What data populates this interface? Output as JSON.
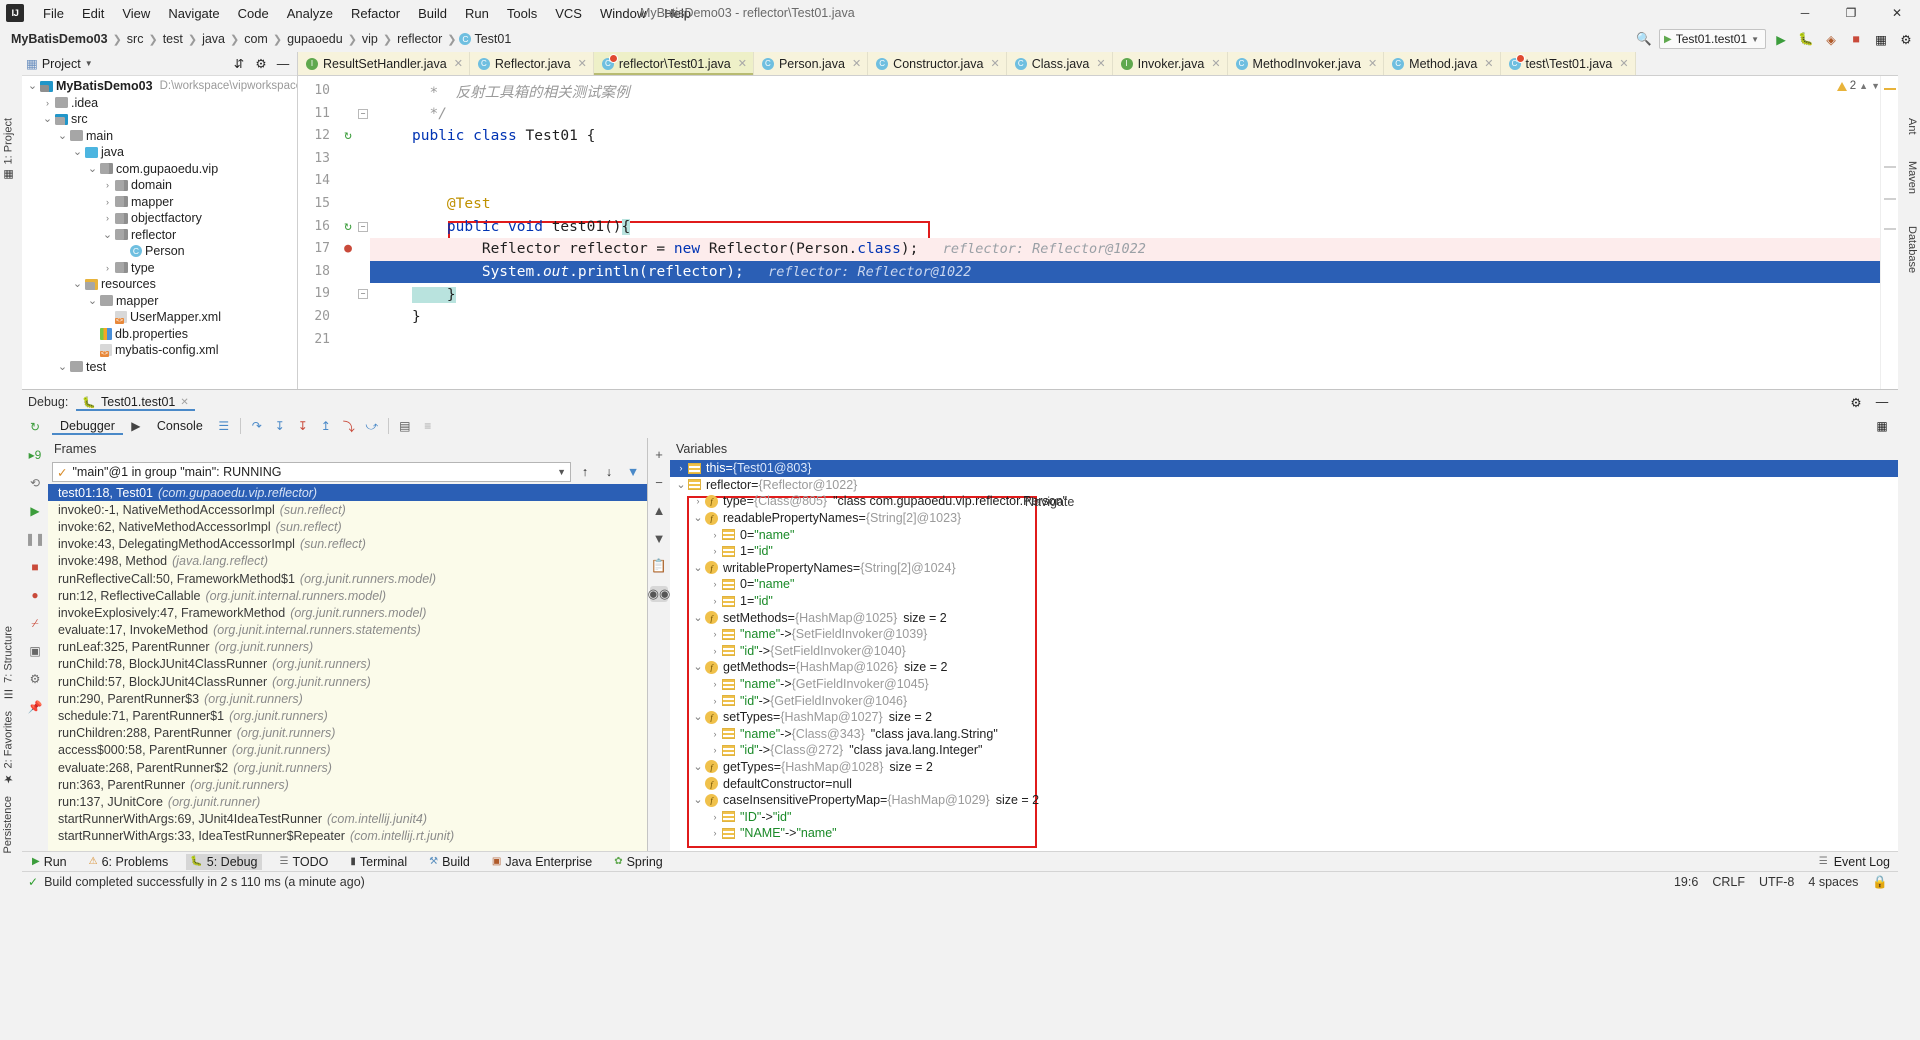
{
  "window": {
    "title": "MyBatisDemo03 - reflector\\Test01.java",
    "logo": "IJ",
    "minimize": "─",
    "maximize": "❐",
    "close": "✕"
  },
  "menu": [
    "File",
    "Edit",
    "View",
    "Navigate",
    "Code",
    "Analyze",
    "Refactor",
    "Build",
    "Run",
    "Tools",
    "VCS",
    "Window",
    "Help"
  ],
  "breadcrumb": [
    "MyBatisDemo03",
    "src",
    "test",
    "java",
    "com",
    "gupaoedu",
    "vip",
    "reflector",
    "Test01"
  ],
  "nav_right": {
    "run_config": "Test01.test01",
    "search_icon": "search-icon",
    "run_icon": "▶",
    "debug_icon": "debug-icon",
    "coverage_icon": "coverage-icon",
    "stop_icon": "■",
    "layout_icon": "layout-icon",
    "settings_icon": "⚙"
  },
  "project_panel": {
    "title": "Project",
    "header_icons": [
      "collapse-all-icon",
      "settings-icon",
      "hide-icon"
    ],
    "tree": [
      {
        "depth": 0,
        "arrow": "v",
        "icon": "proj",
        "label": "MyBatisDemo03",
        "bold": true,
        "path": "D:\\workspace\\vipworkspace\\MyB"
      },
      {
        "depth": 1,
        "arrow": ">",
        "icon": "folder",
        "label": ".idea"
      },
      {
        "depth": 1,
        "arrow": "v",
        "icon": "folder-src",
        "label": "src"
      },
      {
        "depth": 2,
        "arrow": "v",
        "icon": "folder",
        "label": "main"
      },
      {
        "depth": 3,
        "arrow": "v",
        "icon": "folder-java",
        "label": "java"
      },
      {
        "depth": 4,
        "arrow": "v",
        "icon": "pkg",
        "label": "com.gupaoedu.vip"
      },
      {
        "depth": 5,
        "arrow": ">",
        "icon": "pkg",
        "label": "domain"
      },
      {
        "depth": 5,
        "arrow": ">",
        "icon": "pkg",
        "label": "mapper"
      },
      {
        "depth": 5,
        "arrow": ">",
        "icon": "pkg",
        "label": "objectfactory"
      },
      {
        "depth": 5,
        "arrow": "v",
        "icon": "pkg",
        "label": "reflector"
      },
      {
        "depth": 6,
        "arrow": "",
        "icon": "class",
        "label": "Person"
      },
      {
        "depth": 5,
        "arrow": ">",
        "icon": "pkg",
        "label": "type"
      },
      {
        "depth": 3,
        "arrow": "v",
        "icon": "folder-res",
        "label": "resources"
      },
      {
        "depth": 4,
        "arrow": "v",
        "icon": "folder",
        "label": "mapper"
      },
      {
        "depth": 5,
        "arrow": "",
        "icon": "xml",
        "label": "UserMapper.xml"
      },
      {
        "depth": 4,
        "arrow": "",
        "icon": "prop",
        "label": "db.properties"
      },
      {
        "depth": 4,
        "arrow": "",
        "icon": "xml",
        "label": "mybatis-config.xml"
      },
      {
        "depth": 2,
        "arrow": "v",
        "icon": "folder",
        "label": "test"
      }
    ]
  },
  "editor": {
    "tabs": [
      {
        "label": "ResultSetHandler.java",
        "icon": "interface-icon",
        "active": false
      },
      {
        "label": "Reflector.java",
        "icon": "class-icon",
        "active": false
      },
      {
        "label": "reflector\\Test01.java",
        "icon": "test-class-icon",
        "active": true
      },
      {
        "label": "Person.java",
        "icon": "class-icon",
        "active": false
      },
      {
        "label": "Constructor.java",
        "icon": "class-icon",
        "active": false
      },
      {
        "label": "Class.java",
        "icon": "class-icon",
        "active": false
      },
      {
        "label": "Invoker.java",
        "icon": "interface-icon",
        "active": false
      },
      {
        "label": "MethodInvoker.java",
        "icon": "class-icon",
        "active": false
      },
      {
        "label": "Method.java",
        "icon": "class-icon",
        "active": false
      },
      {
        "label": "test\\Test01.java",
        "icon": "test-class-icon",
        "active": false
      }
    ],
    "tab_close": "✕",
    "inspection_count": "2",
    "lines": [
      {
        "num": "10",
        "gutter": "",
        "fold": "",
        "state": "normal",
        "segments": [
          {
            "cls": "cmt",
            "text": "  *  反射工具箱的相关测试案例"
          }
        ]
      },
      {
        "num": "11",
        "gutter": "",
        "fold": "end",
        "state": "normal",
        "segments": [
          {
            "cls": "cmt",
            "text": "  */"
          }
        ]
      },
      {
        "num": "12",
        "gutter": "recursive-icon",
        "fold": "",
        "state": "normal",
        "segments": [
          {
            "cls": "kw",
            "text": "public class "
          },
          {
            "cls": "plain",
            "text": "Test01 {"
          }
        ]
      },
      {
        "num": "13",
        "gutter": "",
        "fold": "",
        "state": "normal",
        "segments": []
      },
      {
        "num": "14",
        "gutter": "",
        "fold": "",
        "state": "normal",
        "segments": []
      },
      {
        "num": "15",
        "gutter": "",
        "fold": "",
        "state": "normal",
        "segments": [
          {
            "cls": "ann",
            "text": "    @Test"
          }
        ]
      },
      {
        "num": "16",
        "gutter": "recursive-icon",
        "fold": "start",
        "state": "normal",
        "segments": [
          {
            "cls": "kw",
            "text": "    public void "
          },
          {
            "cls": "plain",
            "text": "test01()"
          },
          {
            "cls": "caret",
            "text": "{"
          }
        ]
      },
      {
        "num": "17",
        "gutter": "breakpoint-icon",
        "fold": "",
        "state": "exec",
        "segments": [
          {
            "cls": "plain",
            "text": "        Reflector reflector = "
          },
          {
            "cls": "kw",
            "text": "new "
          },
          {
            "cls": "plain",
            "text": "Reflector(Person."
          },
          {
            "cls": "kw",
            "text": "class"
          },
          {
            "cls": "plain",
            "text": ");"
          },
          {
            "cls": "hint",
            "text": "   reflector: Reflector@1022"
          }
        ]
      },
      {
        "num": "18",
        "gutter": "",
        "fold": "",
        "state": "sel",
        "segments": [
          {
            "cls": "plain",
            "text": "        System."
          },
          {
            "cls": "italic",
            "text": "out"
          },
          {
            "cls": "plain",
            "text": ".println(reflector);"
          },
          {
            "cls": "hint",
            "text": "   reflector: Reflector@1022"
          }
        ]
      },
      {
        "num": "19",
        "gutter": "",
        "fold": "end",
        "state": "normal",
        "segments": [
          {
            "cls": "caret",
            "text": "    }"
          }
        ]
      },
      {
        "num": "20",
        "gutter": "",
        "fold": "",
        "state": "normal",
        "segments": [
          {
            "cls": "plain",
            "text": "}"
          }
        ]
      },
      {
        "num": "21",
        "gutter": "",
        "fold": "",
        "state": "normal",
        "segments": []
      }
    ]
  },
  "debug": {
    "label": "Debug:",
    "session_tab": "Test01.test01",
    "session_close": "✕",
    "head_right_icons": [
      "settings-icon",
      "minimize-icon"
    ],
    "toolbar": {
      "tabs": [
        {
          "label": "Debugger",
          "active": true
        },
        {
          "label": "Console",
          "active": false
        }
      ],
      "icons": [
        "layout-icon",
        "step-over-icon",
        "step-into-icon",
        "force-step-into-icon",
        "step-out-icon",
        "drop-frame-icon",
        "run-to-cursor-icon",
        "evaluate-icon",
        "mute-breakpoints-icon"
      ],
      "right_icon": "restore-layout-icon"
    },
    "side_icons": [
      "rerun-icon",
      "rerun-failed-icon",
      "resume-icon",
      "pause-icon",
      "stop-icon",
      "view-breakpoints-icon",
      "mute-breakpoints-icon",
      "settings-icon",
      "pin-icon"
    ],
    "frames": {
      "title": "Frames",
      "thread": "\"main\"@1 in group \"main\": RUNNING",
      "thread_check": "✓",
      "toolbar_icons": [
        "up-icon",
        "down-icon",
        "filter-icon"
      ],
      "items": [
        {
          "text": "test01:18, Test01",
          "pkg": "(com.gupaoedu.vip.reflector)",
          "active": true
        },
        {
          "text": "invoke0:-1, NativeMethodAccessorImpl",
          "pkg": "(sun.reflect)",
          "active": false
        },
        {
          "text": "invoke:62, NativeMethodAccessorImpl",
          "pkg": "(sun.reflect)",
          "active": false
        },
        {
          "text": "invoke:43, DelegatingMethodAccessorImpl",
          "pkg": "(sun.reflect)",
          "active": false
        },
        {
          "text": "invoke:498, Method",
          "pkg": "(java.lang.reflect)",
          "active": false
        },
        {
          "text": "runReflectiveCall:50, FrameworkMethod$1",
          "pkg": "(org.junit.runners.model)",
          "active": false
        },
        {
          "text": "run:12, ReflectiveCallable",
          "pkg": "(org.junit.internal.runners.model)",
          "active": false
        },
        {
          "text": "invokeExplosively:47, FrameworkMethod",
          "pkg": "(org.junit.runners.model)",
          "active": false
        },
        {
          "text": "evaluate:17, InvokeMethod",
          "pkg": "(org.junit.internal.runners.statements)",
          "active": false
        },
        {
          "text": "runLeaf:325, ParentRunner",
          "pkg": "(org.junit.runners)",
          "active": false
        },
        {
          "text": "runChild:78, BlockJUnit4ClassRunner",
          "pkg": "(org.junit.runners)",
          "active": false
        },
        {
          "text": "runChild:57, BlockJUnit4ClassRunner",
          "pkg": "(org.junit.runners)",
          "active": false
        },
        {
          "text": "run:290, ParentRunner$3",
          "pkg": "(org.junit.runners)",
          "active": false
        },
        {
          "text": "schedule:71, ParentRunner$1",
          "pkg": "(org.junit.runners)",
          "active": false
        },
        {
          "text": "runChildren:288, ParentRunner",
          "pkg": "(org.junit.runners)",
          "active": false
        },
        {
          "text": "access$000:58, ParentRunner",
          "pkg": "(org.junit.runners)",
          "active": false
        },
        {
          "text": "evaluate:268, ParentRunner$2",
          "pkg": "(org.junit.runners)",
          "active": false
        },
        {
          "text": "run:363, ParentRunner",
          "pkg": "(org.junit.runners)",
          "active": false
        },
        {
          "text": "run:137, JUnitCore",
          "pkg": "(org.junit.runner)",
          "active": false
        },
        {
          "text": "startRunnerWithArgs:69, JUnit4IdeaTestRunner",
          "pkg": "(com.intellij.junit4)",
          "active": false
        },
        {
          "text": "startRunnerWithArgs:33, IdeaTestRunner$Repeater",
          "pkg": "(com.intellij.rt.junit)",
          "active": false
        }
      ]
    },
    "variables": {
      "title": "Variables",
      "navigate_label": "Navigate",
      "toolbar_icons": [
        "add-icon",
        "remove-icon",
        "up-icon",
        "down-icon",
        "copy-icon",
        "inspect-icon"
      ],
      "items": [
        {
          "depth": 0,
          "arrow": ">",
          "icon": "list",
          "name": "this",
          "eq": " = ",
          "val": "{Test01@803}",
          "valcls": "gray",
          "sel": true
        },
        {
          "depth": 0,
          "arrow": "v",
          "icon": "list",
          "name": "reflector",
          "eq": " = ",
          "val": "{Reflector@1022}",
          "valcls": "gray"
        },
        {
          "depth": 1,
          "arrow": ">",
          "icon": "field",
          "name": "type",
          "eq": " = ",
          "val": "{Class@805}",
          "valcls": "gray",
          "extra": "\"class com.gupaoedu.vip.reflector.Person\"",
          "extracls": "plain"
        },
        {
          "depth": 1,
          "arrow": "v",
          "icon": "field",
          "name": "readablePropertyNames",
          "eq": " = ",
          "val": "{String[2]@1023}",
          "valcls": "gray"
        },
        {
          "depth": 2,
          "arrow": ">",
          "icon": "list",
          "name": "0",
          "eq": " = ",
          "val": "\"name\"",
          "valcls": "str"
        },
        {
          "depth": 2,
          "arrow": ">",
          "icon": "list",
          "name": "1",
          "eq": " = ",
          "val": "\"id\"",
          "valcls": "str"
        },
        {
          "depth": 1,
          "arrow": "v",
          "icon": "field",
          "name": "writablePropertyNames",
          "eq": " = ",
          "val": "{String[2]@1024}",
          "valcls": "gray"
        },
        {
          "depth": 2,
          "arrow": ">",
          "icon": "list",
          "name": "0",
          "eq": " = ",
          "val": "\"name\"",
          "valcls": "str"
        },
        {
          "depth": 2,
          "arrow": ">",
          "icon": "list",
          "name": "1",
          "eq": " = ",
          "val": "\"id\"",
          "valcls": "str"
        },
        {
          "depth": 1,
          "arrow": "v",
          "icon": "field",
          "name": "setMethods",
          "eq": " = ",
          "val": "{HashMap@1025}",
          "valcls": "gray",
          "extra": "size = 2",
          "extracls": "plain"
        },
        {
          "depth": 2,
          "arrow": ">",
          "icon": "list",
          "name": "\"name\"",
          "eq": " -> ",
          "val": "{SetFieldInvoker@1039}",
          "valcls": "gray",
          "namecls": "str"
        },
        {
          "depth": 2,
          "arrow": ">",
          "icon": "list",
          "name": "\"id\"",
          "eq": " -> ",
          "val": "{SetFieldInvoker@1040}",
          "valcls": "gray",
          "namecls": "str"
        },
        {
          "depth": 1,
          "arrow": "v",
          "icon": "field",
          "name": "getMethods",
          "eq": " = ",
          "val": "{HashMap@1026}",
          "valcls": "gray",
          "extra": "size = 2",
          "extracls": "plain"
        },
        {
          "depth": 2,
          "arrow": ">",
          "icon": "list",
          "name": "\"name\"",
          "eq": " -> ",
          "val": "{GetFieldInvoker@1045}",
          "valcls": "gray",
          "namecls": "str"
        },
        {
          "depth": 2,
          "arrow": ">",
          "icon": "list",
          "name": "\"id\"",
          "eq": " -> ",
          "val": "{GetFieldInvoker@1046}",
          "valcls": "gray",
          "namecls": "str"
        },
        {
          "depth": 1,
          "arrow": "v",
          "icon": "field",
          "name": "setTypes",
          "eq": " = ",
          "val": "{HashMap@1027}",
          "valcls": "gray",
          "extra": "size = 2",
          "extracls": "plain"
        },
        {
          "depth": 2,
          "arrow": ">",
          "icon": "list",
          "name": "\"name\"",
          "eq": " -> ",
          "val": "{Class@343}",
          "valcls": "gray",
          "namecls": "str",
          "extra": "\"class java.lang.String\"",
          "extracls": "plain"
        },
        {
          "depth": 2,
          "arrow": ">",
          "icon": "list",
          "name": "\"id\"",
          "eq": " -> ",
          "val": "{Class@272}",
          "valcls": "gray",
          "namecls": "str",
          "extra": "\"class java.lang.Integer\"",
          "extracls": "plain"
        },
        {
          "depth": 1,
          "arrow": "v",
          "icon": "field",
          "name": "getTypes",
          "eq": " = ",
          "val": "{HashMap@1028}",
          "valcls": "gray",
          "extra": "size = 2",
          "extracls": "plain"
        },
        {
          "depth": 1,
          "arrow": "",
          "icon": "field",
          "name": "defaultConstructor",
          "eq": " = ",
          "val": "null",
          "valcls": "plain"
        },
        {
          "depth": 1,
          "arrow": "v",
          "icon": "field",
          "name": "caseInsensitivePropertyMap",
          "eq": " = ",
          "val": "{HashMap@1029}",
          "valcls": "gray",
          "extra": "size = 2",
          "extracls": "plain"
        },
        {
          "depth": 2,
          "arrow": ">",
          "icon": "list",
          "name": "\"ID\"",
          "eq": " -> ",
          "val": "\"id\"",
          "valcls": "str",
          "namecls": "str"
        },
        {
          "depth": 2,
          "arrow": ">",
          "icon": "list",
          "name": "\"NAME\"",
          "eq": " -> ",
          "val": "\"name\"",
          "valcls": "str",
          "namecls": "str"
        }
      ]
    }
  },
  "left_strip": [
    {
      "label": "1: Project",
      "icon": "project-icon"
    },
    {
      "label": "7: Structure",
      "icon": "structure-icon"
    },
    {
      "label": "2: Favorites",
      "icon": "star-icon"
    },
    {
      "label": "Persistence",
      "icon": "persistence-icon"
    }
  ],
  "right_strip": [
    {
      "label": "Ant",
      "icon": "ant-icon"
    },
    {
      "label": "Maven",
      "icon": "maven-icon"
    },
    {
      "label": "Database",
      "icon": "database-icon"
    }
  ],
  "toolwindow_bar": [
    {
      "label": "Run",
      "icon": "run-icon",
      "active": false
    },
    {
      "label": "6: Problems",
      "icon": "problems-icon",
      "active": false
    },
    {
      "label": "5: Debug",
      "icon": "debug-icon",
      "active": true
    },
    {
      "label": "TODO",
      "icon": "todo-icon",
      "active": false
    },
    {
      "label": "Terminal",
      "icon": "terminal-icon",
      "active": false
    },
    {
      "label": "Build",
      "icon": "build-icon",
      "active": false
    },
    {
      "label": "Java Enterprise",
      "icon": "java-enterprise-icon",
      "active": false
    },
    {
      "label": "Spring",
      "icon": "spring-icon",
      "active": false
    }
  ],
  "toolwindow_right": {
    "event_log": "Event Log",
    "icon": "event-log-icon"
  },
  "statusbar": {
    "message": "Build completed successfully in 2 s 110 ms (a minute ago)",
    "check": "✓",
    "position": "19:6",
    "line_sep": "CRLF",
    "encoding": "UTF-8",
    "indent": "4 spaces",
    "lock_icon": "lock-icon"
  }
}
